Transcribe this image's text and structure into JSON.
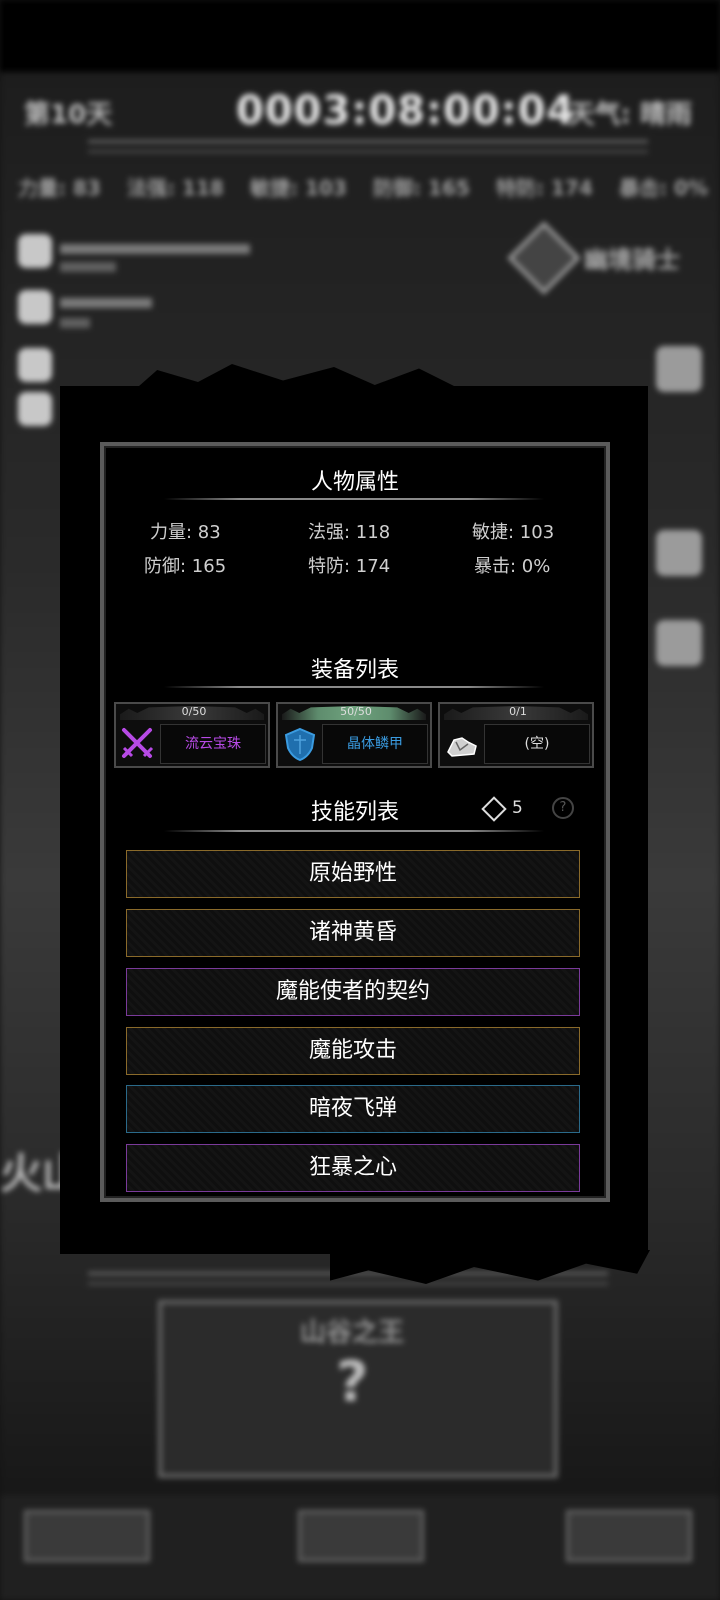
{
  "background": {
    "day": "第10天",
    "clock": "0003:08:00:04",
    "weather": "天气: 晴雨",
    "boss": "幽境骑士",
    "land": "火山",
    "bottom_title": "山谷之王",
    "bottom_question": "?"
  },
  "dialog": {
    "attributes_title": "人物属性",
    "attributes": [
      {
        "label": "力量: 83"
      },
      {
        "label": "法强: 118"
      },
      {
        "label": "敏捷: 103"
      },
      {
        "label": "防御: 165"
      },
      {
        "label": "特防: 174"
      },
      {
        "label": "暴击: 0%"
      }
    ],
    "equipment_title": "装备列表",
    "equipment": [
      {
        "durability": "0/50",
        "durability_fraction": 0,
        "name": "流云宝珠",
        "color": "#b74ae6",
        "icon": "crossed-swords-icon"
      },
      {
        "durability": "50/50",
        "durability_fraction": 1,
        "name": "晶体鳞甲",
        "color": "#3a9be0",
        "icon": "shield-icon"
      },
      {
        "durability": "0/1",
        "durability_fraction": 0,
        "name": "(空)",
        "color": "#dddddd",
        "icon": "rock-icon"
      }
    ],
    "skills_title": "技能列表",
    "skill_points": "5",
    "help": "?",
    "skills": [
      {
        "name": "原始野性",
        "rarity": "gold"
      },
      {
        "name": "诸神黄昏",
        "rarity": "gold"
      },
      {
        "name": "魔能使者的契约",
        "rarity": "purple"
      },
      {
        "name": "魔能攻击",
        "rarity": "gold"
      },
      {
        "name": "暗夜飞弹",
        "rarity": "blue"
      },
      {
        "name": "狂暴之心",
        "rarity": "purple"
      }
    ]
  }
}
